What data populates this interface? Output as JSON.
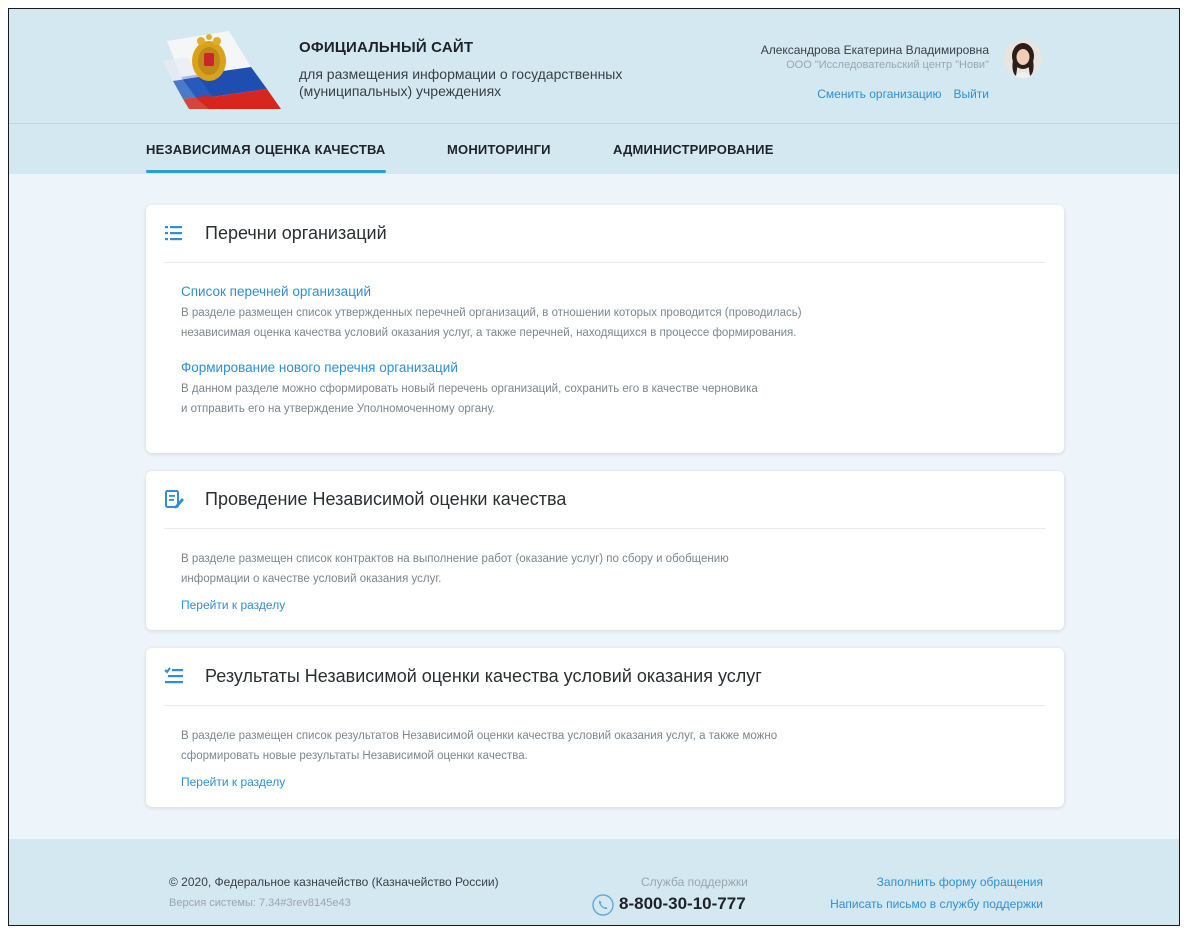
{
  "header": {
    "site_title": "ОФИЦИАЛЬНЫЙ САЙТ",
    "site_subtitle_line1": "для размещения информации о государственных",
    "site_subtitle_line2": "(муниципальных) учреждениях",
    "user_name": "Александрова Екатерина Владимировна",
    "user_org": "ООО \"Исследовательский центр \"Нови\"",
    "change_org_label": "Сменить организацию",
    "logout_label": "Выйти"
  },
  "nav": {
    "items": [
      {
        "label": "НЕЗАВИСИМАЯ ОЦЕНКА КАЧЕСТВА",
        "active": true
      },
      {
        "label": "МОНИТОРИНГИ",
        "active": false
      },
      {
        "label": "АДМИНИСТРИРОВАНИЕ",
        "active": false
      }
    ]
  },
  "cards": [
    {
      "title": "Перечни организаций",
      "icon": "list-icon",
      "sections": [
        {
          "link": "Список перечней организаций",
          "desc_line1": "В разделе размещен список утвержденных перечней организаций, в отношении которых проводится (проводилась)",
          "desc_line2": "независимая оценка качества условий оказания услуг, а также перечней, находящихся в процессе формирования."
        },
        {
          "link": "Формирование нового перечня организаций",
          "desc_line1": "В данном разделе можно сформировать новый перечень организаций, сохранить его в качестве черновика",
          "desc_line2": "и отправить его на утверждение Уполномоченному органу."
        }
      ]
    },
    {
      "title": "Проведение Независимой оценки качества",
      "icon": "edit-document-icon",
      "desc_line1": "В разделе размещен список контрактов на выполнение работ (оказание услуг) по сбору и обобщению",
      "desc_line2": "информации о качестве условий оказания услуг.",
      "link": "Перейти к разделу"
    },
    {
      "title": "Результаты Независимой оценки качества условий оказания услуг",
      "icon": "checklist-icon",
      "desc_line1": "В разделе размещен список результатов Независимой оценки качества условий оказания услуг, а также можно",
      "desc_line2": "сформировать новые результаты Независимой оценки качества.",
      "link": "Перейти к разделу"
    }
  ],
  "footer": {
    "copyright": "© 2020, Федеральное казначейство (Казначейство России)",
    "version": "Версия системы: 7.34#3rev8145e43",
    "support_label": "Служба поддержки",
    "phone": "8-800-30-10-777",
    "form_link": "Заполнить форму обращения",
    "mail_link": "Написать письмо в службу поддержки"
  },
  "colors": {
    "accent": "#2f8fd3",
    "nav_underline": "#22a5c9",
    "header_bg": "#d4e8f1",
    "page_bg": "#eef5fa"
  }
}
